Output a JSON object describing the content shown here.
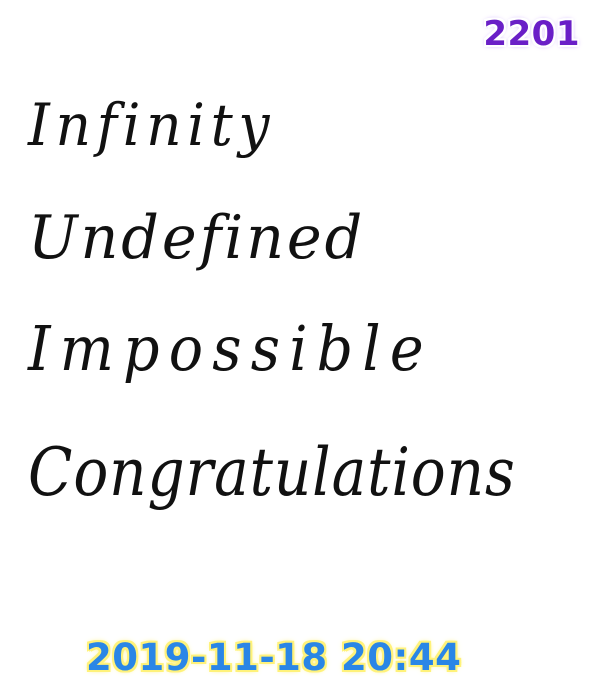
{
  "counter": "2201",
  "handwritten_words": [
    "Infinity",
    "Undefined",
    "Impossible",
    "Congratulations"
  ],
  "timestamp": "2019-11-18 20:44",
  "colors": {
    "counter_text": "#6a1fc7",
    "timestamp_text": "#2a86e6",
    "timestamp_outline": "#fff27a",
    "ink": "#111111",
    "background": "#ffffff"
  }
}
